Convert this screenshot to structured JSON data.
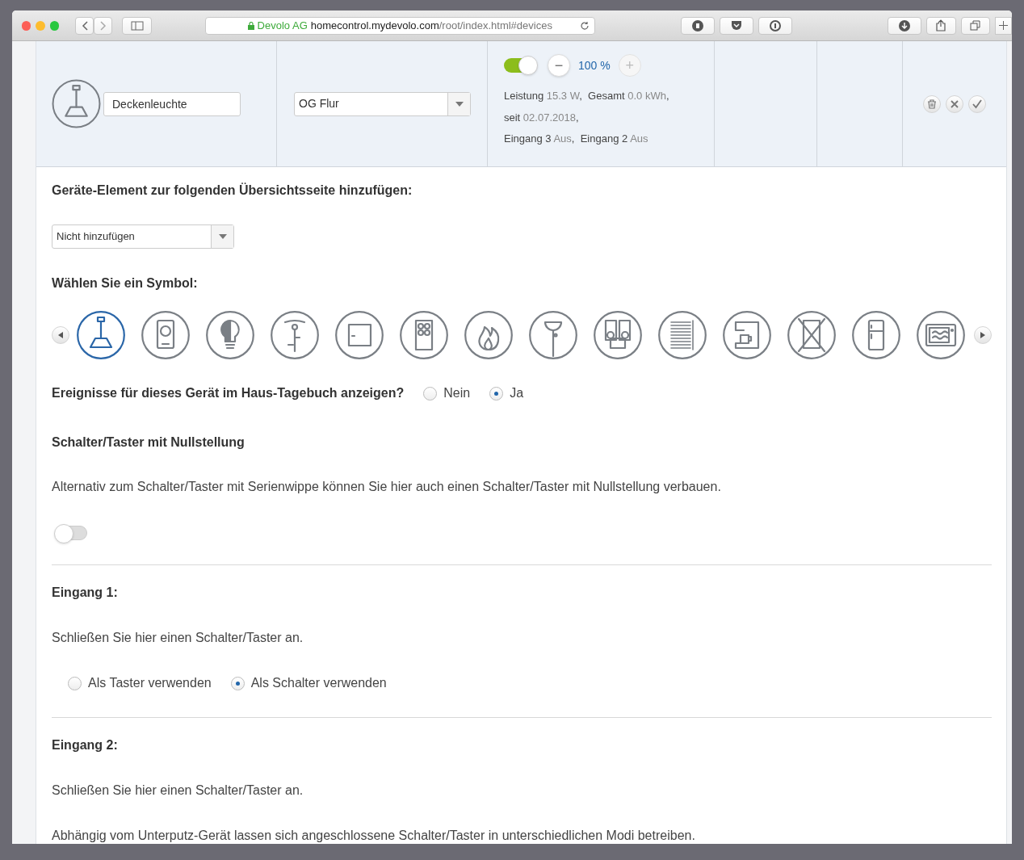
{
  "browser": {
    "owner": "Devolo AG",
    "host": "homecontrol.mydevolo.com",
    "path": "/root/index.html#devices"
  },
  "device": {
    "name": "Deckenleuchte",
    "room": "OG Flur",
    "on": true,
    "level": "100 %",
    "minus": "−",
    "plus": "+",
    "status": [
      "Leistung **15.3 W**,  Gesamt **0.0 kWh**,",
      "seit **02.07.2018**,",
      "Eingang 3 **Aus**,  Eingang 2 **Aus**"
    ]
  },
  "overview": {
    "title": "Geräte-Element zur folgenden Übersichtsseite hinzufügen:",
    "value": "Nicht hinzufügen"
  },
  "symbols": {
    "title": "Wählen Sie ein Symbol:",
    "items": [
      {
        "kind": "lamp",
        "selected": true
      },
      {
        "kind": "socket",
        "selected": false
      },
      {
        "kind": "bulb",
        "selected": false
      },
      {
        "kind": "bike",
        "selected": false
      },
      {
        "kind": "switch",
        "selected": false
      },
      {
        "kind": "keypad",
        "selected": false
      },
      {
        "kind": "fire",
        "selected": false
      },
      {
        "kind": "ceiling",
        "selected": false
      },
      {
        "kind": "stereo",
        "selected": false
      },
      {
        "kind": "blinds",
        "selected": false
      },
      {
        "kind": "coffee",
        "selected": false
      },
      {
        "kind": "washer",
        "selected": false
      },
      {
        "kind": "fridge",
        "selected": false
      },
      {
        "kind": "microwave",
        "selected": false
      }
    ]
  },
  "diary": {
    "question": "Ereignisse für dieses Gerät im Haus-Tagebuch anzeigen?",
    "options": [
      {
        "label": "Nein",
        "selected": false
      },
      {
        "label": "Ja",
        "selected": true
      }
    ]
  },
  "zero": {
    "title": "Schalter/Taster mit Nullstellung",
    "text": "Alternativ zum Schalter/Taster mit Serienwippe können Sie hier auch einen Schalter/Taster mit Nullstellung verbauen.",
    "on": false
  },
  "inputs": [
    {
      "title": "Eingang 1:",
      "texts": [
        "Schließen Sie hier einen Schalter/Taster an."
      ],
      "options": [
        {
          "label": "Als Taster verwenden",
          "selected": false
        },
        {
          "label": "Als Schalter verwenden",
          "selected": true
        }
      ]
    },
    {
      "title": "Eingang 2:",
      "texts": [
        "Schließen Sie hier einen Schalter/Taster an.",
        "Abhängig vom Unterputz-Gerät lassen sich angeschlossene Schalter/Taster in unterschiedlichen Modi betreiben."
      ]
    }
  ]
}
